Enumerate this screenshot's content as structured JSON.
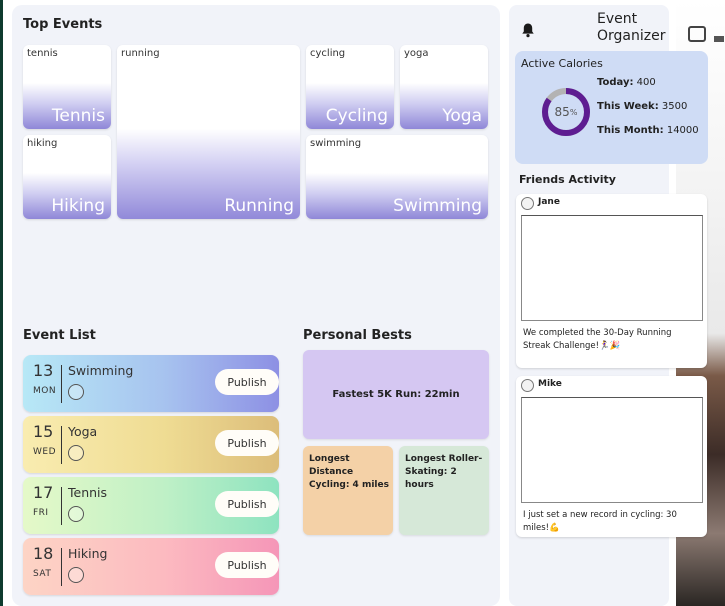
{
  "app": {
    "title": "Event Organizer"
  },
  "top_events": {
    "title": "Top Events",
    "tiles": [
      {
        "tag": "tennis",
        "name": "Tennis"
      },
      {
        "tag": "running",
        "name": "Running"
      },
      {
        "tag": "cycling",
        "name": "Cycling"
      },
      {
        "tag": "yoga",
        "name": "Yoga"
      },
      {
        "tag": "hiking",
        "name": "Hiking"
      },
      {
        "tag": "swimming",
        "name": "Swimming"
      }
    ]
  },
  "event_list": {
    "title": "Event List",
    "items": [
      {
        "day": "13",
        "dow": "MON",
        "name": "Swimming",
        "button": "Publish"
      },
      {
        "day": "15",
        "dow": "WED",
        "name": "Yoga",
        "button": "Publish"
      },
      {
        "day": "17",
        "dow": "FRI",
        "name": "Tennis",
        "button": "Publish"
      },
      {
        "day": "18",
        "dow": "SAT",
        "name": "Hiking",
        "button": "Publish"
      }
    ],
    "colors": [
      "#a6c4f0",
      "#ecd98c",
      "#b6ecc6",
      "#fbb9c2"
    ]
  },
  "personal_bests": {
    "title": "Personal Bests",
    "items": [
      {
        "text": "Fastest 5K Run: 22min",
        "color": "#d5c7f2"
      },
      {
        "text": "Longest Distance Cycling: 4 miles",
        "color": "#f4d1a7"
      },
      {
        "text": "Longest Roller-Skating: 2 hours",
        "color": "#d6e8d8"
      }
    ]
  },
  "calories": {
    "title": "Active Calories",
    "percent": "85",
    "percent_unit": "%",
    "progress": 0.85,
    "ring_color": "#5e1d91",
    "ring_bg": "#b3b3b3",
    "rows": [
      {
        "label": "Today:",
        "value": "400"
      },
      {
        "label": "This Week:",
        "value": "3500"
      },
      {
        "label": "This Month:",
        "value": "14000"
      }
    ]
  },
  "friends": {
    "title": "Friends Activity",
    "posts": [
      {
        "name": "Jane",
        "text": "We completed the 30-Day Running Streak Challenge!🏃‍♀️🎉"
      },
      {
        "name": "Mike",
        "text": "I just set a new record in cycling: 30 miles!💪"
      }
    ]
  },
  "icons": {
    "notifications": "bell-icon"
  }
}
